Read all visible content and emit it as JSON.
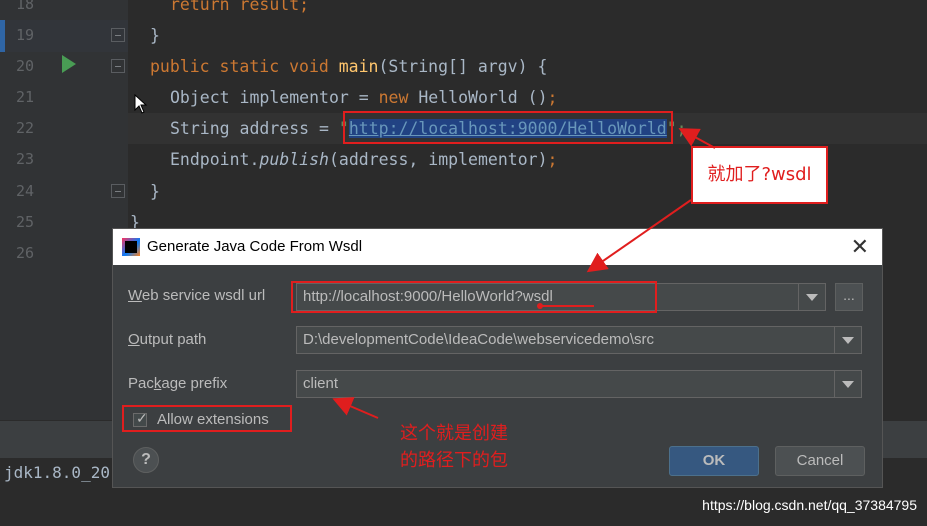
{
  "editor": {
    "line_numbers": [
      "18",
      "19",
      "20",
      "21",
      "22",
      "23",
      "24",
      "25",
      "26"
    ],
    "lines": {
      "l18": "return result;",
      "l19": "}",
      "l20_kw": "public static void ",
      "l20_fn": "main",
      "l20_rest": "(String[] argv) {",
      "l21_a": "Object implementor = ",
      "l21_kw": "new ",
      "l21_b": "HelloWorld ()",
      "l21_c": ";",
      "l22_a": "String address = ",
      "l22_q1": "\"",
      "l22_str": "http://localhost:9000/HelloWorld",
      "l22_q2": "\";",
      "l23_a": "Endpoint.",
      "l23_fn": "publish",
      "l23_b": "(address, implementor)",
      "l23_c": ";",
      "l24": "}",
      "l25": "}"
    },
    "bottom_text": "jdk1.8.0_20"
  },
  "dialog": {
    "title": "Generate Java Code From Wsdl",
    "close": "✕",
    "wsdl_label_mnemonic": "W",
    "wsdl_label_rest": "eb service wsdl url",
    "wsdl_value": "http://localhost:9000/HelloWorld?wsdl",
    "more_button": "...",
    "output_label_mnemonic": "O",
    "output_label_rest": "utput path",
    "output_value": "D:\\developmentCode\\IdeaCode\\webservicedemo\\src",
    "package_label_a": "Pac",
    "package_label_mnemonic": "k",
    "package_label_rest": "age prefix",
    "package_value": "client",
    "allow_extensions_label": "Allow extensions",
    "allow_extensions_checked": true,
    "help": "?",
    "ok": "OK",
    "cancel": "Cancel"
  },
  "annotations": {
    "callout": "就加了?wsdl",
    "note_line1": "这个就是创建",
    "note_line2": "的路径下的包",
    "color": "#e01e1e"
  },
  "watermark": "https://blog.csdn.net/qq_37384795"
}
